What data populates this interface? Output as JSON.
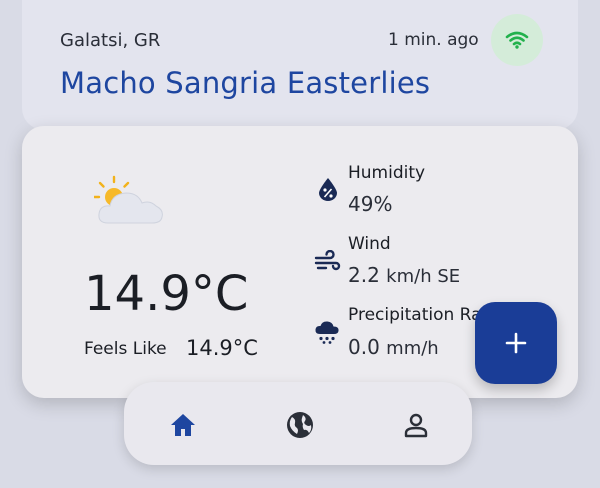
{
  "header": {
    "location": "Galatsi, GR",
    "updated": "1 min. ago",
    "title": "Macho Sangria Easterlies",
    "status_icon": "wifi-icon",
    "status_color": "#22b14c"
  },
  "current": {
    "condition_icon": "partly-cloudy-icon",
    "temperature": "14.9°C",
    "feels_like_label": "Feels Like",
    "feels_like_value": "14.9°C"
  },
  "stats": [
    {
      "label": "Humidity",
      "value": "49%",
      "unit": "",
      "icon": "humidity-drop-icon"
    },
    {
      "label": "Wind",
      "value": "2.2",
      "unit": "km/h SE",
      "icon": "wind-icon"
    },
    {
      "label": "Precipitation Rate",
      "value": "0.0",
      "unit": "mm/h",
      "icon": "rain-cloud-icon"
    }
  ],
  "fab": {
    "label": "+",
    "icon": "add-icon"
  },
  "nav": {
    "items": [
      {
        "name": "home",
        "icon": "home-icon",
        "active": true
      },
      {
        "name": "globe",
        "icon": "globe-icon",
        "active": false
      },
      {
        "name": "profile",
        "icon": "profile-icon",
        "active": false
      }
    ]
  },
  "colors": {
    "accent": "#1e46a0",
    "fab": "#1a3d97",
    "background": "#d9dbe6"
  }
}
